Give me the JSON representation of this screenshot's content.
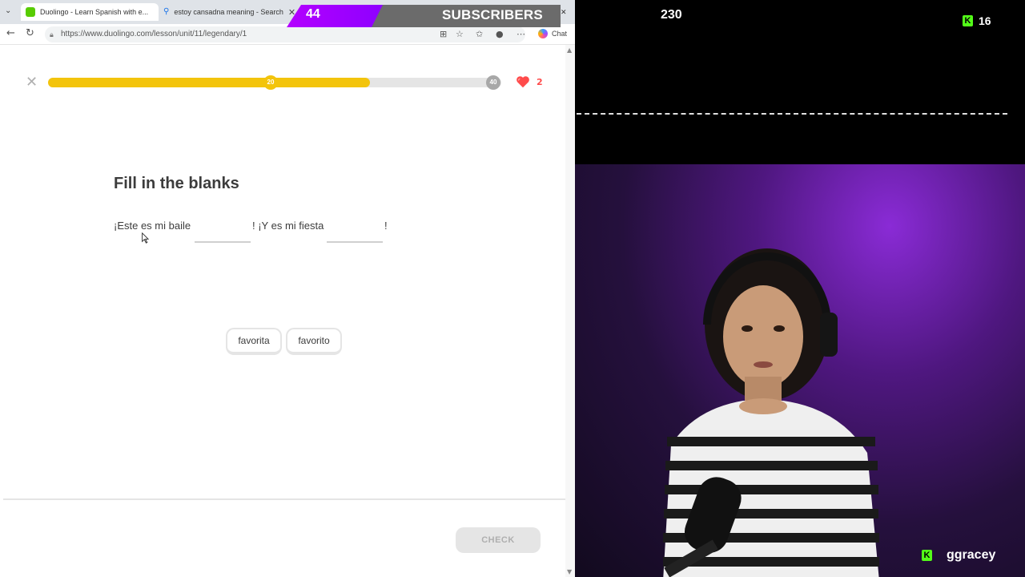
{
  "browser": {
    "tabs": [
      {
        "title": "Duolingo - Learn Spanish with e...",
        "active": true
      },
      {
        "title": "estoy cansadna meaning - Search",
        "active": false
      }
    ],
    "url": "https://www.duolingo.com/lesson/unit/11/legendary/1",
    "chat_label": "Chat"
  },
  "overlay": {
    "subscriber_count": "44",
    "subscriber_label": "SUBSCRIBERS"
  },
  "lesson": {
    "progress_fraction": 0.71,
    "milestones": [
      "20",
      "40"
    ],
    "hearts": "2",
    "prompt_title": "Fill in the blanks",
    "sentence_parts": [
      "¡Este es mi baile",
      "! ¡Y es mi fiesta",
      "!"
    ],
    "word_bank": [
      "favorita",
      "favorito"
    ],
    "check_label": "CHECK"
  },
  "stream": {
    "top_count": "230",
    "kick_count": "16",
    "streamer_name": "ggracey",
    "colors": {
      "kick_green": "#53fc18",
      "accent_purple": "#b400ff"
    }
  }
}
